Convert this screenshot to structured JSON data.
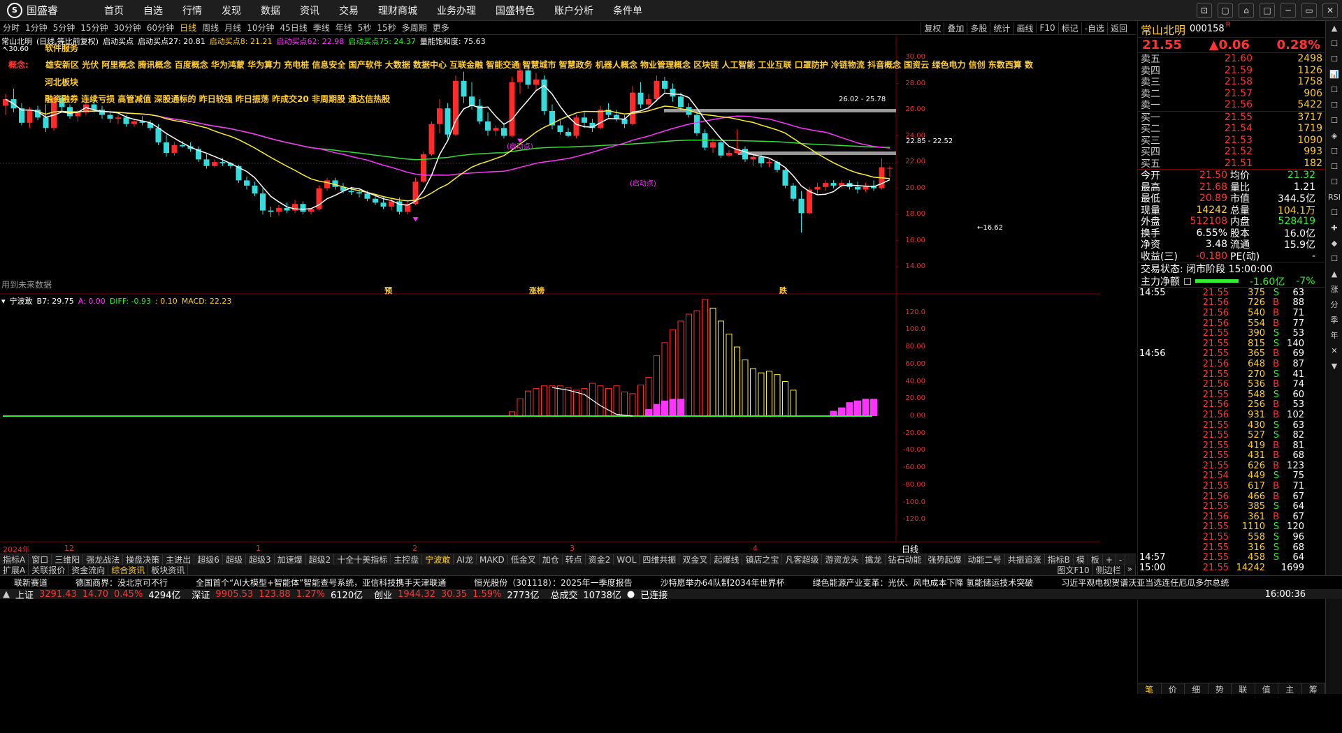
{
  "app": {
    "logo_text": "国盛睿",
    "logo_mark": "S"
  },
  "menu": [
    "首页",
    "自选",
    "行情",
    "发现",
    "数据",
    "资讯",
    "交易",
    "理财商城",
    "业务办理",
    "国盛特色",
    "账户分析",
    "条件单"
  ],
  "window_controls": [
    "⊡",
    "▢",
    "⌂",
    "□",
    "─",
    "▭",
    "✕"
  ],
  "periods": {
    "items": [
      "分时",
      "1分钟",
      "5分钟",
      "15分钟",
      "30分钟",
      "60分钟",
      "日线",
      "周线",
      "月线",
      "10分钟",
      "45日线",
      "季线",
      "年线",
      "5秒",
      "15秒",
      "多周期",
      "更多"
    ],
    "active": "日线"
  },
  "tools": [
    "复权",
    "叠加",
    "多股",
    "统计",
    "画线",
    "F10",
    "标记",
    "-自选",
    "返回"
  ],
  "main_header": {
    "stock": "常山北明",
    "mode": "(日线,等比前复权)",
    "ind_name": "启动买点",
    "p27": "启动买点27: 20.81",
    "p8": "启动买点8: 21.21",
    "p62": "启动买点62: 22.98",
    "p75": "启动买点75: 24.37",
    "vol": "量能饱和度: 75.63"
  },
  "overlay": {
    "sector_label": "软件服务",
    "concept_prefix": "概念:",
    "concepts": "雄安新区 光伏 阿里概念 腾讯概念 百度概念 华为鸿蒙 华为算力 充电桩 信息安全 国产软件 大数据 数据中心 互联金融 智能交通 智慧城市 智慧政务 机器人概念 物业管理概念 区块链 人工智能 工业互联 口罩防护 冷链物流 抖音概念 国资云 绿色电力 信创 东数西算 数",
    "region": "河北板块",
    "tags": "融资融券 连续亏损 高管减值 深股通标的 昨日较强 昨日振荡 昨成交20 非周期股 通达信热股",
    "top_mark": "30.60",
    "no_data": "用到未来数据",
    "events": [
      {
        "label": "预",
        "at": 550
      },
      {
        "label": "涨榜",
        "at": 757
      },
      {
        "label": "跌",
        "at": 1115
      }
    ],
    "signals": [
      "(启动点)",
      "(启动点)"
    ],
    "range1": "26.02 - 25.78",
    "range2": "22.85 - 22.52",
    "low": "16.62"
  },
  "price_axis": [
    "30.00",
    "28.00",
    "26.00",
    "24.00",
    "22.00",
    "20.00",
    "18.00",
    "16.00",
    "14.00"
  ],
  "sub_header": {
    "name": "宁波敢",
    "b7": "B7: 29.75",
    "a": "A: 0.00",
    "diff": "DIFF: -0.93",
    "dea": ": 0.10",
    "macd": "MACD: 22.23"
  },
  "sub_axis": [
    "120.0",
    "100.0",
    "80.00",
    "60.00",
    "40.00",
    "20.00",
    "0.00",
    "-20.00",
    "-40.00",
    "-60.00",
    "-80.00",
    "-100.0",
    "-120.0"
  ],
  "date_axis": [
    {
      "label": "2024年",
      "at": 4
    },
    {
      "label": "12",
      "at": 92
    },
    {
      "label": "1",
      "at": 366
    },
    {
      "label": "2",
      "at": 590
    },
    {
      "label": "3",
      "at": 815
    },
    {
      "label": "4",
      "at": 1077
    }
  ],
  "date_axis_right": "日线",
  "indicator_tabs": {
    "items": [
      "指标A",
      "窗口",
      "三维阳",
      "强龙战法",
      "操盘决策",
      "主进出",
      "超级6",
      "超级",
      "超级3",
      "加速爆",
      "超级2",
      "十全十美指标",
      "主控盘",
      "宁波敢",
      "AI龙",
      "MAKD",
      "低金叉",
      "加仓",
      "转点",
      "资金2",
      "WOL",
      "四维共振",
      "双金叉",
      "起爆线",
      "镇店之宝",
      "凡客超级",
      "游资龙头",
      "擒龙",
      "钻石动能",
      "强势起爆",
      "动能二号",
      "共振追涨",
      "指标B",
      "模",
      "板",
      "+",
      "-"
    ],
    "active": "宁波敢"
  },
  "ext_tabs": {
    "items": [
      "扩展A",
      "关联报价",
      "资金流向",
      "综合资讯",
      "板块资讯"
    ],
    "active": "综合资讯",
    "right": [
      "图文F10",
      "侧边栏",
      "»"
    ]
  },
  "rpanel": {
    "name": "常山北明",
    "code": "000158",
    "code_tag": "R",
    "price": "21.55",
    "change": "▲0.06",
    "pct": "0.28%",
    "asks": [
      {
        "l": "卖五",
        "p": "21.60",
        "v": "2498"
      },
      {
        "l": "卖四",
        "p": "21.59",
        "v": "1126"
      },
      {
        "l": "卖三",
        "p": "21.58",
        "v": "1758"
      },
      {
        "l": "卖二",
        "p": "21.57",
        "v": "906"
      },
      {
        "l": "卖一",
        "p": "21.56",
        "v": "5422"
      }
    ],
    "bids": [
      {
        "l": "买一",
        "p": "21.55",
        "v": "3717"
      },
      {
        "l": "买二",
        "p": "21.54",
        "v": "1719"
      },
      {
        "l": "买三",
        "p": "21.53",
        "v": "1090"
      },
      {
        "l": "买四",
        "p": "21.52",
        "v": "993"
      },
      {
        "l": "买五",
        "p": "21.51",
        "v": "182"
      }
    ],
    "stats": [
      {
        "a": "今开",
        "b": "21.50",
        "c": "均价",
        "d": "21.32"
      },
      {
        "a": "最高",
        "b": "21.68",
        "c": "量比",
        "d": "1.21"
      },
      {
        "a": "最低",
        "b": "20.89",
        "c": "市值",
        "d": "344.5亿"
      },
      {
        "a": "现量",
        "b": "14242",
        "c": "总量",
        "d": "104.1万"
      },
      {
        "a": "外盘",
        "b": "512108",
        "c": "内盘",
        "d": "528419"
      },
      {
        "a": "换手",
        "b": "6.55%",
        "c": "股本",
        "d": "16.0亿"
      },
      {
        "a": "净资",
        "b": "3.48",
        "c": "流通",
        "d": "15.9亿"
      },
      {
        "a": "收益(三)",
        "b": "-0.180",
        "c": "PE(动)",
        "d": "-"
      }
    ],
    "trade_status": "交易状态: 闭市阶段 15:00:00",
    "net_label": "主力净额",
    "net_value": "-1.60亿",
    "net_pct": "-7%",
    "ticks": [
      {
        "t": "14:55",
        "p": "21.55",
        "v": "375",
        "s": "S",
        "n": "63"
      },
      {
        "t": "",
        "p": "21.56",
        "v": "726",
        "s": "B",
        "n": "88"
      },
      {
        "t": "",
        "p": "21.56",
        "v": "540",
        "s": "B",
        "n": "71"
      },
      {
        "t": "",
        "p": "21.56",
        "v": "554",
        "s": "B",
        "n": "77"
      },
      {
        "t": "",
        "p": "21.55",
        "v": "390",
        "s": "S",
        "n": "53"
      },
      {
        "t": "",
        "p": "21.55",
        "v": "815",
        "s": "S",
        "n": "140"
      },
      {
        "t": "14:56",
        "p": "21.55",
        "v": "365",
        "s": "B",
        "n": "69"
      },
      {
        "t": "",
        "p": "21.56",
        "v": "648",
        "s": "B",
        "n": "87"
      },
      {
        "t": "",
        "p": "21.55",
        "v": "270",
        "s": "S",
        "n": "41"
      },
      {
        "t": "",
        "p": "21.56",
        "v": "536",
        "s": "B",
        "n": "74"
      },
      {
        "t": "",
        "p": "21.55",
        "v": "548",
        "s": "S",
        "n": "60"
      },
      {
        "t": "",
        "p": "21.56",
        "v": "256",
        "s": "B",
        "n": "53"
      },
      {
        "t": "",
        "p": "21.56",
        "v": "931",
        "s": "B",
        "n": "102"
      },
      {
        "t": "",
        "p": "21.55",
        "v": "430",
        "s": "S",
        "n": "63"
      },
      {
        "t": "",
        "p": "21.55",
        "v": "527",
        "s": "S",
        "n": "82"
      },
      {
        "t": "",
        "p": "21.55",
        "v": "419",
        "s": "B",
        "n": "81"
      },
      {
        "t": "",
        "p": "21.55",
        "v": "431",
        "s": "B",
        "n": "68"
      },
      {
        "t": "",
        "p": "21.55",
        "v": "626",
        "s": "B",
        "n": "123"
      },
      {
        "t": "",
        "p": "21.54",
        "v": "449",
        "s": "S",
        "n": "75"
      },
      {
        "t": "",
        "p": "21.55",
        "v": "617",
        "s": "B",
        "n": "71"
      },
      {
        "t": "",
        "p": "21.56",
        "v": "466",
        "s": "B",
        "n": "67"
      },
      {
        "t": "",
        "p": "21.55",
        "v": "385",
        "s": "S",
        "n": "64"
      },
      {
        "t": "",
        "p": "21.56",
        "v": "361",
        "s": "B",
        "n": "67"
      },
      {
        "t": "",
        "p": "21.55",
        "v": "1110",
        "s": "S",
        "n": "120"
      },
      {
        "t": "",
        "p": "21.55",
        "v": "558",
        "s": "S",
        "n": "96"
      },
      {
        "t": "",
        "p": "21.55",
        "v": "316",
        "s": "S",
        "n": "68"
      },
      {
        "t": "14:57",
        "p": "21.55",
        "v": "458",
        "s": "S",
        "n": "64"
      },
      {
        "t": "15:00",
        "p": "21.55",
        "v": "14242",
        "s": "",
        "n": "1699"
      }
    ],
    "bottom_tabs": [
      "笔",
      "价",
      "细",
      "势",
      "联",
      "值",
      "主",
      "筹"
    ]
  },
  "side_icons": [
    "▲",
    "☐",
    "☐",
    "📊",
    "☐",
    "☐",
    "☐",
    "◈",
    "☐",
    "☐",
    "☐",
    "RSI",
    "☐",
    "✚",
    "◆",
    "☐",
    "▲",
    "涨",
    "分",
    "季",
    "年",
    "✕",
    "▼"
  ],
  "news": [
    "联新赛道",
    "德国商界：没北京可不行",
    "全国首个“AI大模型+智能体”智能查号系统，亚信科技携手天津联通",
    "恒光股份（301118）：2025年一季度报告",
    "沙特愿举办64队制2034年世界杯",
    "绿色能源产业变革：光伏、风电成本下降 氢能储运技术突破",
    "习近平观电视贺谱沃亚当选连任厄瓜多尔总统"
  ],
  "status": {
    "sh_label": "上证",
    "sh_val": "3291.43",
    "sh_chg": "14.70",
    "sh_pct": "0.45%",
    "sh_amt": "4294亿",
    "sz_label": "深证",
    "sz_val": "9905.53",
    "sz_chg": "123.88",
    "sz_pct": "1.27%",
    "sz_amt": "6120亿",
    "cy_label": "创业",
    "cy_val": "1944.32",
    "cy_chg": "30.35",
    "cy_pct": "1.59%",
    "cy_amt": "2773亿",
    "total_label": "总成交",
    "total_val": "10738亿",
    "conn": "已连接",
    "time": "16:00:36"
  },
  "chart_data": {
    "type": "candlestick",
    "price_ylim": [
      13.0,
      30.8
    ],
    "macd_ylim": [
      -135,
      135
    ],
    "candles": [
      [
        26.3,
        27.2,
        25.6,
        26.8
      ],
      [
        26.8,
        27.6,
        25.8,
        26.1
      ],
      [
        26.1,
        26.5,
        24.8,
        25.0
      ],
      [
        25.0,
        26.2,
        24.6,
        26.0
      ],
      [
        26.0,
        26.3,
        25.2,
        25.4
      ],
      [
        25.4,
        26.4,
        24.3,
        24.6
      ],
      [
        24.6,
        27.1,
        24.4,
        26.9
      ],
      [
        26.9,
        27.1,
        25.9,
        26.2
      ],
      [
        26.2,
        26.4,
        25.3,
        25.5
      ],
      [
        25.5,
        26.0,
        25.1,
        25.8
      ],
      [
        25.8,
        26.7,
        25.6,
        26.4
      ],
      [
        26.4,
        26.9,
        25.8,
        26.0
      ],
      [
        26.0,
        26.3,
        25.3,
        25.6
      ],
      [
        25.6,
        25.9,
        25.0,
        25.3
      ],
      [
        25.3,
        25.6,
        24.9,
        25.4
      ],
      [
        25.4,
        25.6,
        24.7,
        24.9
      ],
      [
        24.9,
        25.3,
        24.7,
        25.1
      ],
      [
        25.1,
        25.5,
        24.8,
        25.0
      ],
      [
        25.0,
        25.2,
        24.4,
        24.6
      ],
      [
        24.6,
        24.9,
        23.3,
        23.5
      ],
      [
        23.5,
        24.1,
        22.4,
        22.7
      ],
      [
        22.7,
        23.5,
        22.5,
        23.3
      ],
      [
        23.3,
        23.6,
        23.1,
        23.2
      ],
      [
        23.2,
        23.5,
        22.8,
        23.0
      ],
      [
        23.0,
        23.2,
        22.0,
        22.2
      ],
      [
        22.2,
        22.6,
        21.5,
        21.7
      ],
      [
        21.7,
        22.2,
        21.6,
        22.0
      ],
      [
        22.0,
        22.3,
        21.7,
        21.9
      ],
      [
        21.9,
        22.0,
        21.5,
        21.7
      ],
      [
        21.7,
        21.8,
        20.4,
        20.6
      ],
      [
        20.6,
        20.9,
        19.9,
        20.2
      ],
      [
        20.2,
        20.5,
        19.4,
        19.6
      ],
      [
        19.6,
        20.0,
        18.0,
        18.3
      ],
      [
        18.3,
        18.6,
        17.8,
        18.2
      ],
      [
        18.2,
        18.7,
        17.9,
        18.5
      ],
      [
        18.5,
        18.9,
        18.1,
        18.3
      ],
      [
        18.3,
        19.1,
        18.1,
        18.8
      ],
      [
        18.8,
        19.0,
        18.0,
        18.2
      ],
      [
        18.2,
        18.5,
        18.0,
        18.4
      ],
      [
        18.4,
        20.2,
        18.3,
        20.0
      ],
      [
        20.0,
        20.8,
        19.8,
        20.6
      ],
      [
        20.6,
        20.8,
        19.9,
        20.1
      ],
      [
        20.1,
        20.4,
        19.6,
        19.8
      ],
      [
        19.8,
        20.1,
        19.5,
        19.7
      ],
      [
        19.7,
        19.9,
        19.3,
        19.6
      ],
      [
        19.6,
        19.8,
        19.0,
        19.2
      ],
      [
        19.2,
        19.4,
        18.7,
        18.9
      ],
      [
        18.9,
        19.3,
        18.4,
        18.6
      ],
      [
        18.6,
        19.2,
        18.3,
        19.0
      ],
      [
        19.0,
        19.3,
        18.0,
        18.2
      ],
      [
        18.2,
        19.0,
        18.0,
        18.8
      ],
      [
        18.8,
        20.8,
        18.7,
        20.5
      ],
      [
        20.5,
        22.8,
        20.4,
        22.6
      ],
      [
        22.6,
        25.1,
        22.5,
        24.9
      ],
      [
        24.9,
        26.8,
        24.2,
        26.1
      ],
      [
        26.1,
        26.5,
        23.8,
        24.1
      ],
      [
        24.1,
        28.6,
        24.0,
        28.2
      ],
      [
        28.2,
        28.9,
        26.5,
        27.0
      ],
      [
        27.0,
        28.1,
        26.0,
        26.3
      ],
      [
        26.3,
        26.8,
        24.9,
        25.1
      ],
      [
        25.1,
        25.8,
        24.0,
        24.4
      ],
      [
        24.4,
        24.8,
        24.0,
        24.6
      ],
      [
        24.6,
        25.0,
        23.8,
        24.0
      ],
      [
        24.0,
        28.5,
        23.9,
        28.1
      ],
      [
        28.1,
        29.6,
        27.2,
        29.0
      ],
      [
        29.0,
        29.3,
        27.6,
        27.9
      ],
      [
        27.9,
        28.8,
        27.5,
        28.3
      ],
      [
        28.3,
        28.6,
        25.6,
        25.9
      ],
      [
        25.9,
        26.4,
        24.5,
        24.8
      ],
      [
        24.8,
        25.2,
        24.1,
        24.3
      ],
      [
        24.3,
        24.6,
        23.9,
        24.0
      ],
      [
        24.0,
        25.6,
        23.8,
        25.4
      ],
      [
        25.4,
        25.8,
        24.6,
        25.0
      ],
      [
        25.0,
        25.3,
        24.3,
        24.6
      ],
      [
        24.6,
        26.3,
        24.5,
        26.0
      ],
      [
        26.0,
        26.5,
        25.4,
        25.6
      ],
      [
        25.6,
        26.0,
        25.1,
        25.3
      ],
      [
        25.3,
        25.6,
        24.6,
        24.9
      ],
      [
        24.9,
        27.8,
        24.8,
        27.3
      ],
      [
        27.3,
        28.1,
        26.1,
        26.4
      ],
      [
        26.4,
        27.2,
        26.0,
        26.8
      ],
      [
        26.8,
        28.6,
        26.6,
        28.2
      ],
      [
        28.2,
        28.5,
        27.3,
        27.6
      ],
      [
        27.6,
        28.0,
        26.6,
        27.0
      ],
      [
        27.0,
        27.3,
        26.0,
        26.2
      ],
      [
        26.2,
        26.5,
        25.4,
        25.6
      ],
      [
        25.6,
        25.8,
        24.0,
        24.2
      ],
      [
        24.2,
        24.5,
        22.9,
        23.1
      ],
      [
        23.1,
        23.8,
        22.7,
        23.5
      ],
      [
        23.5,
        23.7,
        22.3,
        22.5
      ],
      [
        22.5,
        22.9,
        22.4,
        22.7
      ],
      [
        22.7,
        24.5,
        22.6,
        23.0
      ],
      [
        23.0,
        23.2,
        22.0,
        22.2
      ],
      [
        22.2,
        22.6,
        21.7,
        22.4
      ],
      [
        22.4,
        22.6,
        21.6,
        21.9
      ],
      [
        21.9,
        22.3,
        21.6,
        22.0
      ],
      [
        22.0,
        22.1,
        21.2,
        21.4
      ],
      [
        21.4,
        21.5,
        20.0,
        20.2
      ],
      [
        20.2,
        20.4,
        19.0,
        19.2
      ],
      [
        19.2,
        19.8,
        16.62,
        18.1
      ],
      [
        18.1,
        20.1,
        18.0,
        19.9
      ],
      [
        19.9,
        20.4,
        19.5,
        20.1
      ],
      [
        20.1,
        20.6,
        19.8,
        20.4
      ],
      [
        20.4,
        20.6,
        20.0,
        20.2
      ],
      [
        20.2,
        20.6,
        20.0,
        20.4
      ],
      [
        20.4,
        20.6,
        19.9,
        20.1
      ],
      [
        20.1,
        20.5,
        19.6,
        19.9
      ],
      [
        19.9,
        20.4,
        19.7,
        20.2
      ],
      [
        20.2,
        20.6,
        19.8,
        20.0
      ],
      [
        20.0,
        22.3,
        19.9,
        21.6
      ],
      [
        21.5,
        21.68,
        20.89,
        21.55
      ]
    ],
    "macd_bars": [
      0,
      0,
      0,
      0,
      0,
      0,
      0,
      0,
      0,
      0,
      0,
      0,
      0,
      0,
      0,
      0,
      0,
      0,
      0,
      0,
      0,
      0,
      0,
      0,
      0,
      0,
      0,
      0,
      0,
      0,
      0,
      0,
      0,
      0,
      0,
      0,
      0,
      0,
      0,
      0,
      0,
      0,
      0,
      0,
      0,
      0,
      0,
      0,
      0,
      0,
      0,
      0,
      0,
      0,
      0,
      0,
      0,
      0,
      0,
      0,
      0,
      0,
      0,
      5,
      20,
      29,
      32,
      35,
      35,
      35,
      33,
      30,
      32,
      38,
      35,
      32,
      35,
      28,
      26,
      36,
      45,
      70,
      85,
      100,
      110,
      118,
      122,
      135,
      125,
      110,
      95,
      80,
      65,
      55,
      50,
      52,
      48,
      40,
      30,
      0,
      0,
      0,
      0,
      0,
      0,
      0,
      0,
      0,
      0,
      0,
      0,
      0,
      0,
      0,
      0,
      0,
      0,
      0,
      0,
      0,
      0,
      0,
      0,
      0,
      0,
      0,
      0,
      0
    ]
  }
}
